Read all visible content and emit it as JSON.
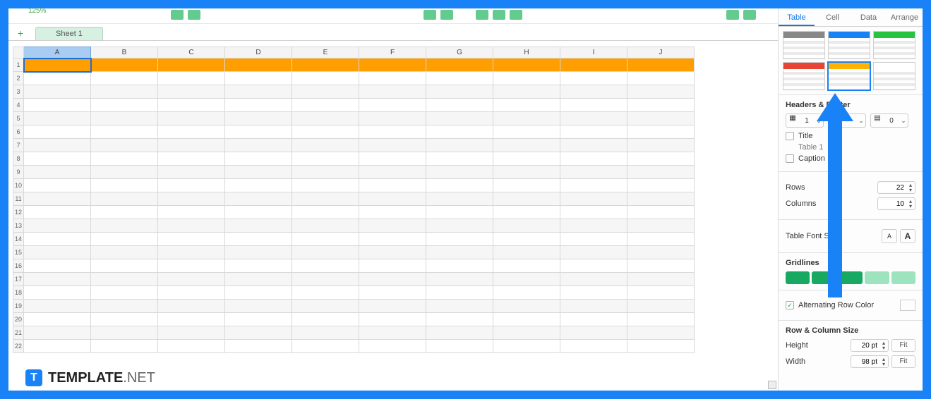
{
  "toolbar": {
    "zoom": "125%"
  },
  "tabs": {
    "sheet1": "Sheet 1"
  },
  "columns": [
    "A",
    "B",
    "C",
    "D",
    "E",
    "F",
    "G",
    "H",
    "I",
    "J"
  ],
  "row_headers": [
    "1",
    "2",
    "3",
    "4",
    "5",
    "6",
    "7",
    "8",
    "9",
    "10",
    "11",
    "12",
    "13",
    "14",
    "15",
    "16",
    "17",
    "18",
    "19",
    "20",
    "21",
    "22"
  ],
  "inspector": {
    "tabs": {
      "table": "Table",
      "cell": "Cell",
      "data": "Data",
      "arrange": "Arrange"
    },
    "hf_title": "Headers & Footer",
    "hf_val1": "1",
    "hf_val2": "0",
    "title_chk": "Title",
    "title_sub": "Table 1",
    "caption_chk": "Caption",
    "rows_lbl": "Rows",
    "rows_val": "22",
    "cols_lbl": "Columns",
    "cols_val": "10",
    "font_lbl": "Table Font Size",
    "font_small": "A",
    "font_big": "A",
    "grid_lbl": "Gridlines",
    "alt_lbl": "Alternating Row Color",
    "rcs_title": "Row & Column Size",
    "height_lbl": "Height",
    "height_val": "20 pt",
    "width_lbl": "Width",
    "width_val": "98 pt",
    "fit": "Fit"
  },
  "style_colors": [
    "#888888",
    "#1a82f7",
    "#28c441",
    "#e74436",
    "#ffb300",
    "#ffffff"
  ],
  "watermark": {
    "logo": "T",
    "text1": "TEMPLATE",
    "text2": ".NET"
  }
}
